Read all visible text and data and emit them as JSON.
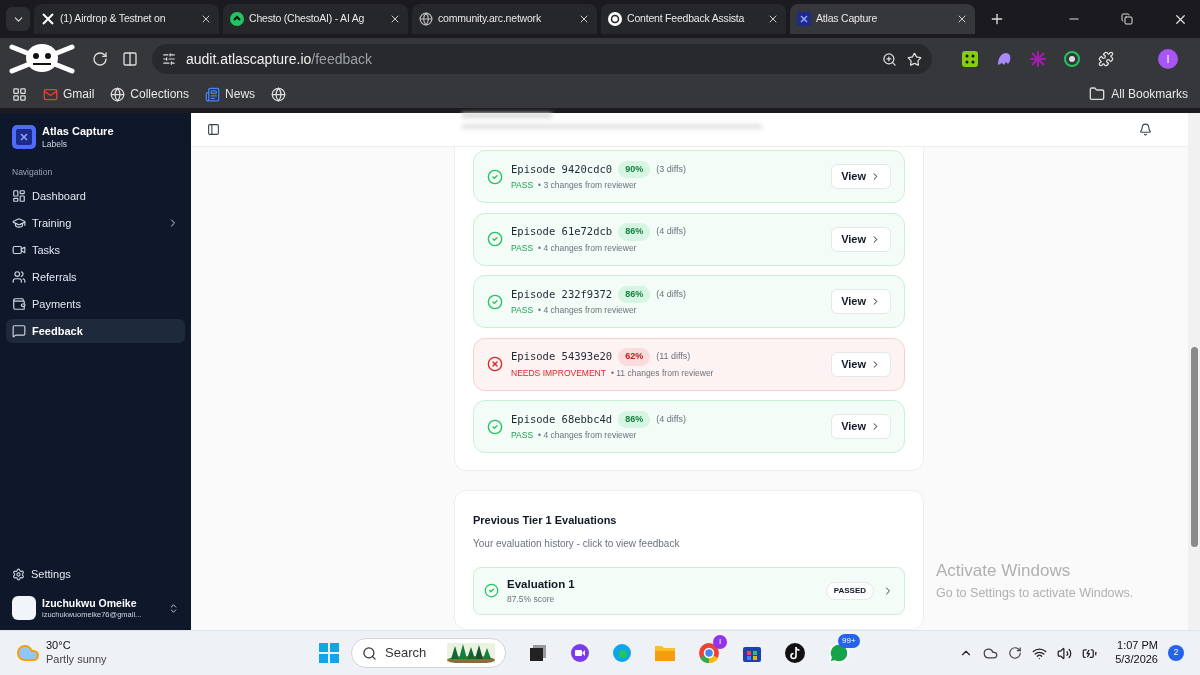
{
  "browser": {
    "tabs": [
      {
        "title": "(1) Airdrop & Testnet on",
        "kind": "x",
        "selected": false
      },
      {
        "title": "Chesto (ChestoAI) - AI Ag",
        "kind": "green",
        "selected": false
      },
      {
        "title": "community.arc.network",
        "kind": "globe",
        "selected": false
      },
      {
        "title": "Content Feedback Assista",
        "kind": "chat",
        "selected": false
      },
      {
        "title": "Atlas Capture",
        "kind": "atlas",
        "selected": true
      }
    ],
    "address": {
      "host": "audit.atlascapture.io",
      "path": "/feedback"
    },
    "profile_initial": "I",
    "bookmarks": [
      {
        "label": "Gmail",
        "kind": "mail"
      },
      {
        "label": "Collections",
        "kind": "globe"
      },
      {
        "label": "News",
        "kind": "news"
      },
      {
        "kind": "globe"
      }
    ],
    "all_bookmarks": "All Bookmarks"
  },
  "sidebar": {
    "brand": "Atlas Capture",
    "brand_sub": "Labels",
    "section": "Navigation",
    "items": [
      {
        "label": "Dashboard",
        "kind": "dashboard",
        "selected": false,
        "submenu": false
      },
      {
        "label": "Training",
        "kind": "training",
        "selected": false,
        "submenu": true
      },
      {
        "label": "Tasks",
        "kind": "tasks",
        "selected": false,
        "submenu": false
      },
      {
        "label": "Referrals",
        "kind": "referrals",
        "selected": false,
        "submenu": false
      },
      {
        "label": "Payments",
        "kind": "payments",
        "selected": false,
        "submenu": false
      },
      {
        "label": "Feedback",
        "kind": "feedback",
        "selected": true,
        "submenu": false
      }
    ],
    "settings": "Settings",
    "user": {
      "name": "Izuchukwu Omeike",
      "email": "izuchukwuomeike76@gmail..."
    }
  },
  "episodes": [
    {
      "title": "Episode 9420cdc0",
      "score": "90%",
      "diffs": "(3 diffs)",
      "status": "PASS",
      "note": "• 3 changes from reviewer",
      "kind": "pass",
      "action": "View"
    },
    {
      "title": "Episode 61e72dcb",
      "score": "86%",
      "diffs": "(4 diffs)",
      "status": "PASS",
      "note": "• 4 changes from reviewer",
      "kind": "pass",
      "action": "View"
    },
    {
      "title": "Episode 232f9372",
      "score": "86%",
      "diffs": "(4 diffs)",
      "status": "PASS",
      "note": "• 4 changes from reviewer",
      "kind": "pass",
      "action": "View"
    },
    {
      "title": "Episode 54393e20",
      "score": "62%",
      "diffs": "(11 diffs)",
      "status": "NEEDS IMPROVEMENT",
      "note": "• 11 changes from reviewer",
      "kind": "fail",
      "action": "View"
    },
    {
      "title": "Episode 68ebbc4d",
      "score": "86%",
      "diffs": "(4 diffs)",
      "status": "PASS",
      "note": "• 4 changes from reviewer",
      "kind": "pass",
      "action": "View"
    }
  ],
  "evaluations": {
    "title": "Previous Tier 1 Evaluations",
    "subtitle": "Your evaluation history - click to view feedback",
    "items": [
      {
        "title": "Evaluation 1",
        "score": "87.5% score",
        "badge": "PASSED"
      }
    ]
  },
  "activation": {
    "title": "Activate Windows",
    "subtitle": "Go to Settings to activate Windows."
  },
  "taskbar": {
    "temperature": "30°C",
    "condition": "Partly sunny",
    "search": "Search",
    "chrome_badge": "I",
    "whatsapp_badge": "99+",
    "time": "1:07 PM",
    "date": "5/3/2026",
    "notifications": "2"
  }
}
